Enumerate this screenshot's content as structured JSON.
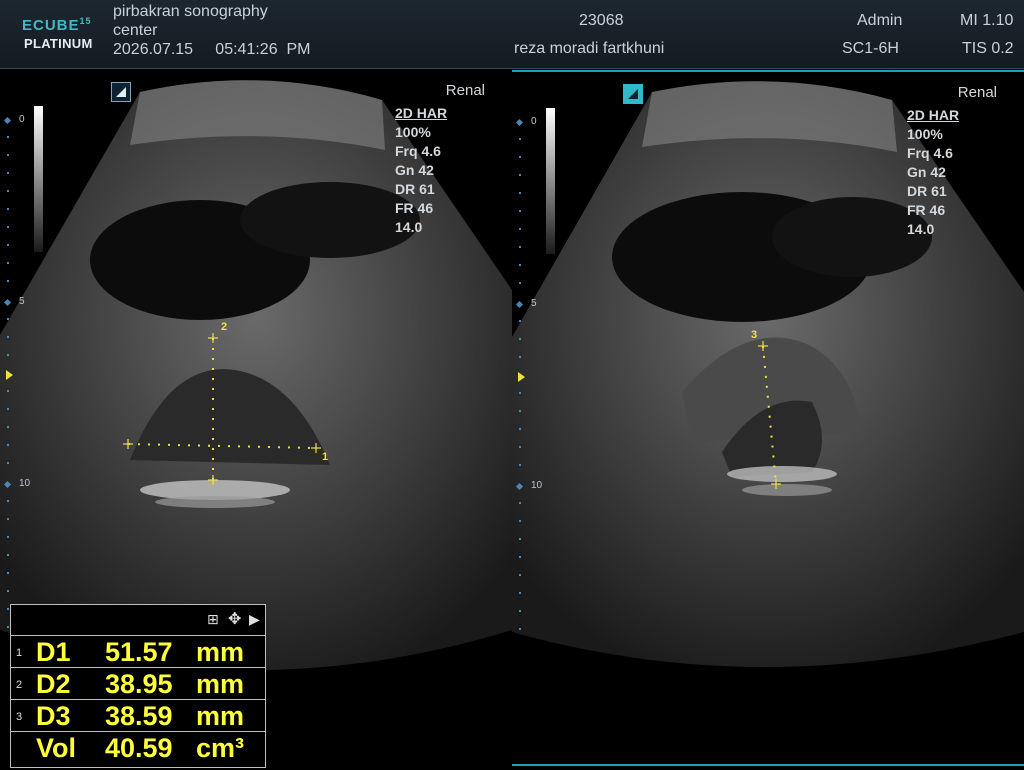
{
  "header": {
    "logo_top": "ECUBE",
    "logo_num": "15",
    "logo_bottom": "PLATINUM",
    "institution_line1": "pirbakran sonography",
    "institution_line2": "center",
    "datetime": "2026.07.15     05:41:26  PM",
    "patient_id": "23068",
    "patient_name": "reza moradi fartkhuni",
    "operator": "Admin",
    "probe": "SC1-6H",
    "mi": "MI 1.10",
    "tis": "TIS 0.2"
  },
  "panels": [
    {
      "preset": "Renal",
      "mode": "2D HAR",
      "power": "100%",
      "freq": "Frq 4.6",
      "gain": "Gn 42",
      "dr": "DR 61",
      "fr": "FR 46",
      "depth": "14.0",
      "depth_labels": [
        "0",
        "5",
        "10"
      ],
      "calipers": [
        "1",
        "2"
      ]
    },
    {
      "preset": "Renal",
      "mode": "2D HAR",
      "power": "100%",
      "freq": "Frq 4.6",
      "gain": "Gn 42",
      "dr": "DR 61",
      "fr": "FR 46",
      "depth": "14.0",
      "depth_labels": [
        "0",
        "5",
        "10"
      ],
      "calipers": [
        "3"
      ]
    }
  ],
  "measurements": {
    "header_icons": [
      "grid-icon",
      "move-icon",
      "expand-arrow-icon"
    ],
    "header_glyphs": [
      "⊞",
      "✥",
      "▶"
    ],
    "rows": [
      {
        "num": "1",
        "name": "D1",
        "value": "51.57",
        "unit": "mm"
      },
      {
        "num": "2",
        "name": "D2",
        "value": "38.95",
        "unit": "mm"
      },
      {
        "num": "3",
        "name": "D3",
        "value": "38.59",
        "unit": "mm"
      },
      {
        "num": "",
        "name": "Vol",
        "value": "40.59",
        "unit": "cm³"
      }
    ]
  },
  "colors": {
    "accent": "#2eb8c8",
    "caliper": "#f0e23a",
    "measurement_text": "#ffff3c"
  }
}
